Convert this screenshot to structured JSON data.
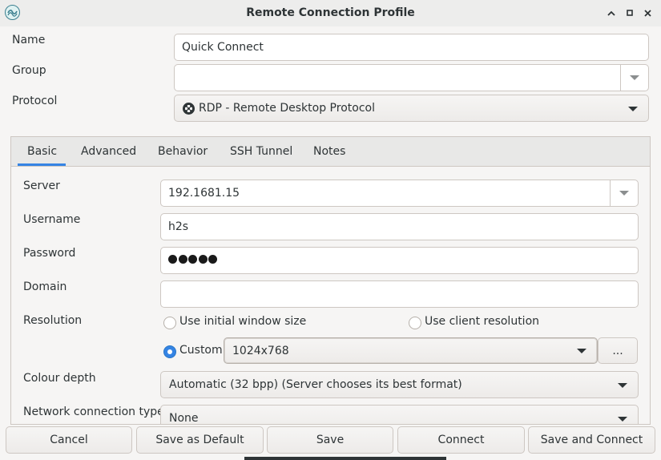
{
  "window": {
    "title": "Remote Connection Profile",
    "icon": "remmina-app-icon",
    "controls": [
      "minimize-icon",
      "maximize-icon",
      "close-icon"
    ]
  },
  "profile": {
    "name_label": "Name",
    "name_value": "Quick Connect",
    "group_label": "Group",
    "group_value": "",
    "protocol_label": "Protocol",
    "protocol_value": "RDP - Remote Desktop Protocol"
  },
  "tabs": [
    {
      "label": "Basic",
      "active": true
    },
    {
      "label": "Advanced"
    },
    {
      "label": "Behavior"
    },
    {
      "label": "SSH Tunnel"
    },
    {
      "label": "Notes"
    }
  ],
  "basic": {
    "server_label": "Server",
    "server_value": "192.1681.15",
    "username_label": "Username",
    "username_value": "h2s",
    "password_label": "Password",
    "password_length": 5,
    "domain_label": "Domain",
    "domain_value": "",
    "resolution_label": "Resolution",
    "res_initial": "Use initial window size",
    "res_client": "Use client resolution",
    "res_custom": "Custom",
    "res_custom_value": "1024x768",
    "res_more": "...",
    "colour_label": "Colour depth",
    "colour_value": "Automatic (32 bpp) (Server chooses its best format)",
    "network_label": "Network connection type",
    "network_value": "None"
  },
  "buttons": {
    "cancel": "Cancel",
    "save_default": "Save as Default",
    "save": "Save",
    "connect": "Connect",
    "save_connect": "Save and Connect"
  },
  "colors": {
    "accent": "#3584e4",
    "background": "#f6f5f4",
    "border": "#cdc7c2"
  }
}
